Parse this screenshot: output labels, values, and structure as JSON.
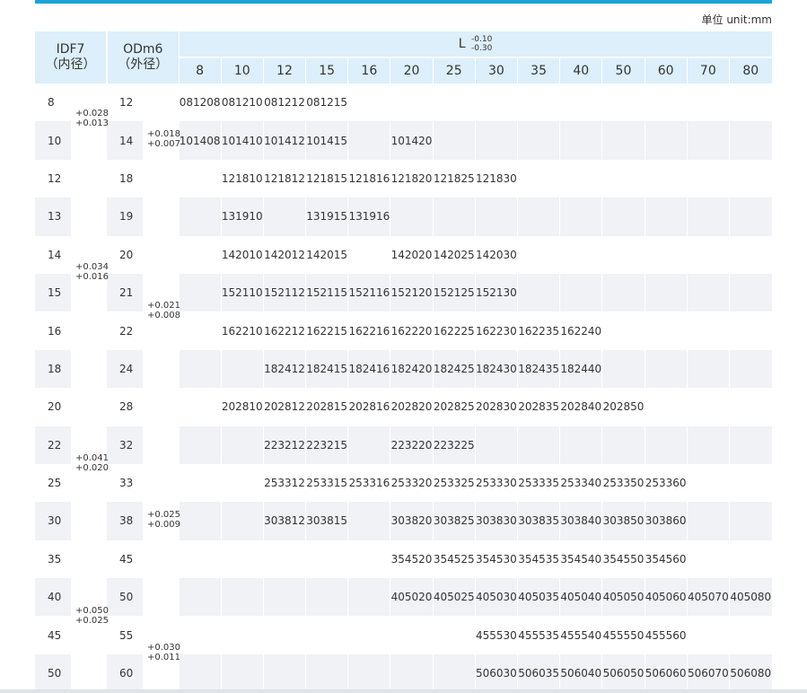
{
  "unit_label": "单位 unit:mm",
  "header": {
    "id_label": "IDF7",
    "id_sub": "（内径）",
    "od_label": "ODm6",
    "od_sub": "（外径）",
    "l_label": "L",
    "l_tol_upper": "-0.10",
    "l_tol_lower": "-0.30",
    "lengths": [
      "8",
      "10",
      "12",
      "15",
      "16",
      "20",
      "25",
      "30",
      "35",
      "40",
      "50",
      "60",
      "70",
      "80"
    ]
  },
  "id_tolerances": [
    {
      "upper": "+0.028",
      "lower": "+0.013"
    },
    {
      "upper": "+0.034",
      "lower": "+0.016"
    },
    {
      "upper": "+0.041",
      "lower": "+0.020"
    },
    {
      "upper": "+0.050",
      "lower": "+0.025"
    }
  ],
  "od_tolerances": [
    {
      "upper": "+0.018",
      "lower": "+0.007"
    },
    {
      "upper": "+0.021",
      "lower": "+0.008"
    },
    {
      "upper": "+0.025",
      "lower": "+0.009"
    },
    {
      "upper": "+0.030",
      "lower": "+0.011"
    }
  ],
  "rows": [
    {
      "id": "8",
      "od": "12",
      "cells": [
        "081208",
        "081210",
        "081212",
        "081215",
        "",
        "",
        "",
        "",
        "",
        "",
        "",
        "",
        "",
        ""
      ]
    },
    {
      "id": "10",
      "od": "14",
      "cells": [
        "101408",
        "101410",
        "101412",
        "101415",
        "",
        "101420",
        "",
        "",
        "",
        "",
        "",
        "",
        "",
        ""
      ]
    },
    {
      "id": "12",
      "od": "18",
      "cells": [
        "",
        "121810",
        "121812",
        "121815",
        "121816",
        "121820",
        "121825",
        "121830",
        "",
        "",
        "",
        "",
        "",
        ""
      ]
    },
    {
      "id": "13",
      "od": "19",
      "cells": [
        "",
        "131910",
        "",
        "131915",
        "131916",
        "",
        "",
        "",
        "",
        "",
        "",
        "",
        "",
        ""
      ]
    },
    {
      "id": "14",
      "od": "20",
      "cells": [
        "",
        "142010",
        "142012",
        "142015",
        "",
        "142020",
        "142025",
        "142030",
        "",
        "",
        "",
        "",
        "",
        ""
      ]
    },
    {
      "id": "15",
      "od": "21",
      "cells": [
        "",
        "152110",
        "152112",
        "152115",
        "152116",
        "152120",
        "152125",
        "152130",
        "",
        "",
        "",
        "",
        "",
        ""
      ]
    },
    {
      "id": "16",
      "od": "22",
      "cells": [
        "",
        "162210",
        "162212",
        "162215",
        "162216",
        "162220",
        "162225",
        "162230",
        "162235",
        "162240",
        "",
        "",
        "",
        ""
      ]
    },
    {
      "id": "18",
      "od": "24",
      "cells": [
        "",
        "",
        "182412",
        "182415",
        "182416",
        "182420",
        "182425",
        "182430",
        "182435",
        "182440",
        "",
        "",
        "",
        ""
      ]
    },
    {
      "id": "20",
      "od": "28",
      "cells": [
        "",
        "202810",
        "202812",
        "202815",
        "202816",
        "202820",
        "202825",
        "202830",
        "202835",
        "202840",
        "202850",
        "",
        "",
        ""
      ]
    },
    {
      "id": "22",
      "od": "32",
      "cells": [
        "",
        "",
        "223212",
        "223215",
        "",
        "223220",
        "223225",
        "",
        "",
        "",
        "",
        "",
        "",
        ""
      ]
    },
    {
      "id": "25",
      "od": "33",
      "cells": [
        "",
        "",
        "253312",
        "253315",
        "253316",
        "253320",
        "253325",
        "253330",
        "253335",
        "253340",
        "253350",
        "253360",
        "",
        ""
      ]
    },
    {
      "id": "30",
      "od": "38",
      "cells": [
        "",
        "",
        "303812",
        "303815",
        "",
        "303820",
        "303825",
        "303830",
        "303835",
        "303840",
        "303850",
        "303860",
        "",
        ""
      ]
    },
    {
      "id": "35",
      "od": "45",
      "cells": [
        "",
        "",
        "",
        "",
        "",
        "354520",
        "354525",
        "354530",
        "354535",
        "354540",
        "354550",
        "354560",
        "",
        ""
      ]
    },
    {
      "id": "40",
      "od": "50",
      "cells": [
        "",
        "",
        "",
        "",
        "",
        "405020",
        "405025",
        "405030",
        "405035",
        "405040",
        "405050",
        "405060",
        "405070",
        "405080"
      ]
    },
    {
      "id": "45",
      "od": "55",
      "cells": [
        "",
        "",
        "",
        "",
        "",
        "",
        "",
        "455530",
        "455535",
        "455540",
        "455550",
        "455560",
        "",
        ""
      ]
    },
    {
      "id": "50",
      "od": "60",
      "cells": [
        "",
        "",
        "",
        "",
        "",
        "",
        "",
        "506030",
        "506035",
        "506040",
        "506050",
        "506060",
        "506070",
        "506080"
      ]
    }
  ]
}
